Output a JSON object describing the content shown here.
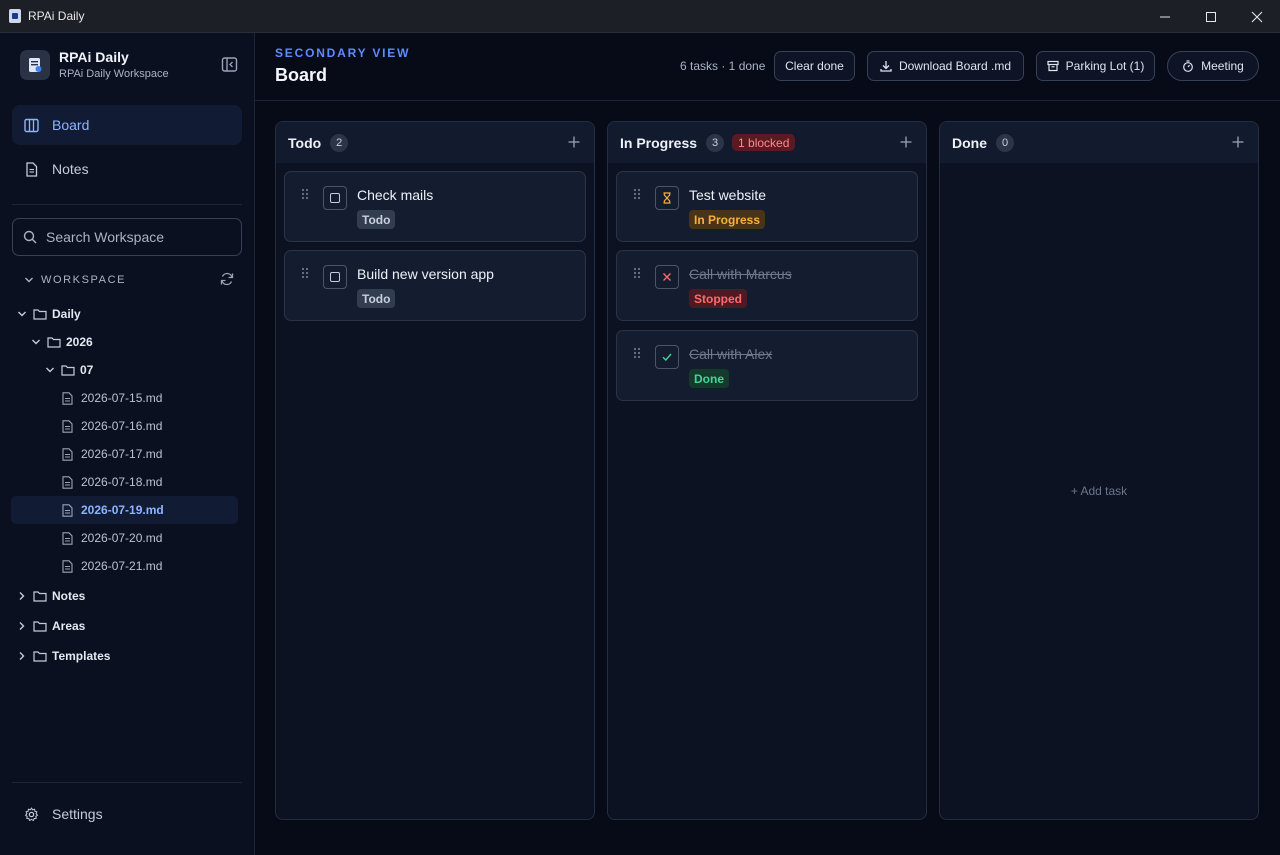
{
  "window": {
    "title": "RPAi Daily"
  },
  "sidebar": {
    "brand_name": "RPAi Daily",
    "brand_sub": "RPAi Daily Workspace",
    "nav": [
      {
        "label": "Board",
        "active": true
      },
      {
        "label": "Notes",
        "active": false
      }
    ],
    "search_placeholder": "Search Workspace",
    "workspace_label": "WORKSPACE",
    "tree": {
      "daily": "Daily",
      "year": "2026",
      "month": "07",
      "files": [
        "2026-07-15.md",
        "2026-07-16.md",
        "2026-07-17.md",
        "2026-07-18.md",
        "2026-07-19.md",
        "2026-07-20.md",
        "2026-07-21.md"
      ],
      "selected_file": "2026-07-19.md",
      "folders": [
        "Notes",
        "Areas",
        "Templates"
      ]
    },
    "settings_label": "Settings"
  },
  "header": {
    "eyebrow": "SECONDARY VIEW",
    "title": "Board",
    "meta": "6 tasks · 1 done",
    "buttons": {
      "clear_done": "Clear done",
      "download": "Download Board .md",
      "parking_lot": "Parking Lot (1)",
      "meeting": "Meeting"
    }
  },
  "columns": [
    {
      "title": "Todo",
      "count": "2",
      "cards": [
        {
          "title": "Check mails",
          "status": "Todo"
        },
        {
          "title": "Build new version app",
          "status": "Todo"
        }
      ]
    },
    {
      "title": "In Progress",
      "count": "3",
      "blocked": "1 blocked",
      "cards": [
        {
          "title": "Test website",
          "status": "In Progress"
        },
        {
          "title": "Call with Marcus",
          "status": "Stopped"
        },
        {
          "title": "Call with Alex",
          "status": "Done"
        }
      ]
    },
    {
      "title": "Done",
      "count": "0",
      "empty_label": "+ Add task",
      "cards": []
    }
  ],
  "colors": {
    "accent": "#5b8cff",
    "active_nav": "#8eb4ff",
    "in_progress": "#f7b23b",
    "stopped": "#ff6b6b",
    "done": "#43d49a",
    "background": "#070b18"
  }
}
